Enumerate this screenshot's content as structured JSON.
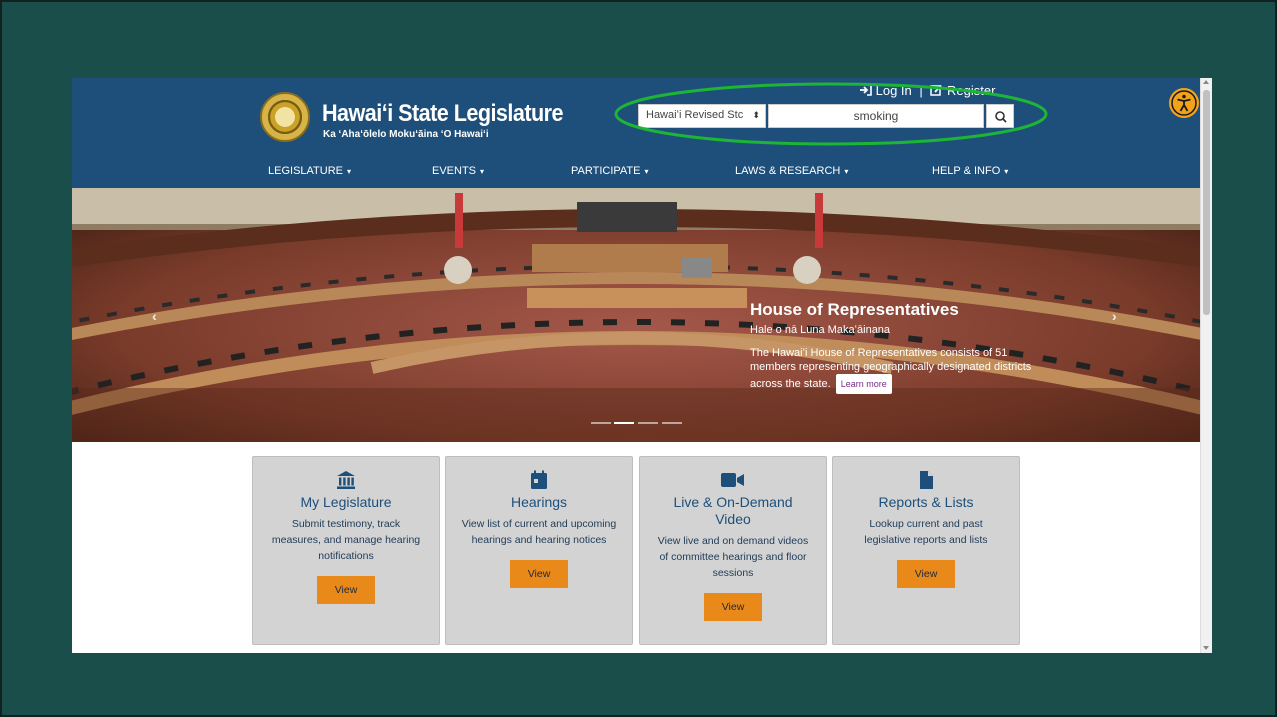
{
  "site": {
    "title": "Hawaiʻi State Legislature",
    "subtitle": "Ka ʻAhaʻōlelo Mokuʻāina ʻO Hawaiʻi"
  },
  "auth": {
    "login_label": "Log In",
    "separator": "|",
    "register_label": "Register"
  },
  "search": {
    "scope_selected": "Hawaiʻi Revised Stc",
    "query": "smoking"
  },
  "nav": [
    {
      "label": "LEGISLATURE"
    },
    {
      "label": "EVENTS"
    },
    {
      "label": "PARTICIPATE"
    },
    {
      "label": "LAWS & RESEARCH"
    },
    {
      "label": "HELP & INFO"
    }
  ],
  "hero": {
    "title": "House of Representatives",
    "subtitle": "Hale o nā Luna Makaʻāinana",
    "description": "The Hawaiʻi House of Representatives consists of 51 members representing geographically designated districts across the state.",
    "button_label": "Learn more",
    "slide_count": 4,
    "active_slide": 2
  },
  "cards": [
    {
      "icon": "building-icon",
      "title": "My Legislature",
      "description": "Submit testimony, track measures, and manage hearing notifications",
      "button_label": "View"
    },
    {
      "icon": "calendar-icon",
      "title": "Hearings",
      "description": "View list of current and upcoming hearings and hearing notices",
      "button_label": "View"
    },
    {
      "icon": "video-camera-icon",
      "title": "Live & On-Demand Video",
      "description": "View live and on demand videos of committee hearings and floor sessions",
      "button_label": "View"
    },
    {
      "icon": "document-icon",
      "title": "Reports & Lists",
      "description": "Lookup current and past legislative reports and lists",
      "button_label": "View"
    }
  ],
  "colors": {
    "background": "#1a4e4a",
    "header": "#1e4f7a",
    "accent_orange": "#e8891a",
    "card_bg": "#d3d3d3",
    "highlight_ellipse": "#1db535",
    "accessibility_button": "#f2a31a"
  }
}
